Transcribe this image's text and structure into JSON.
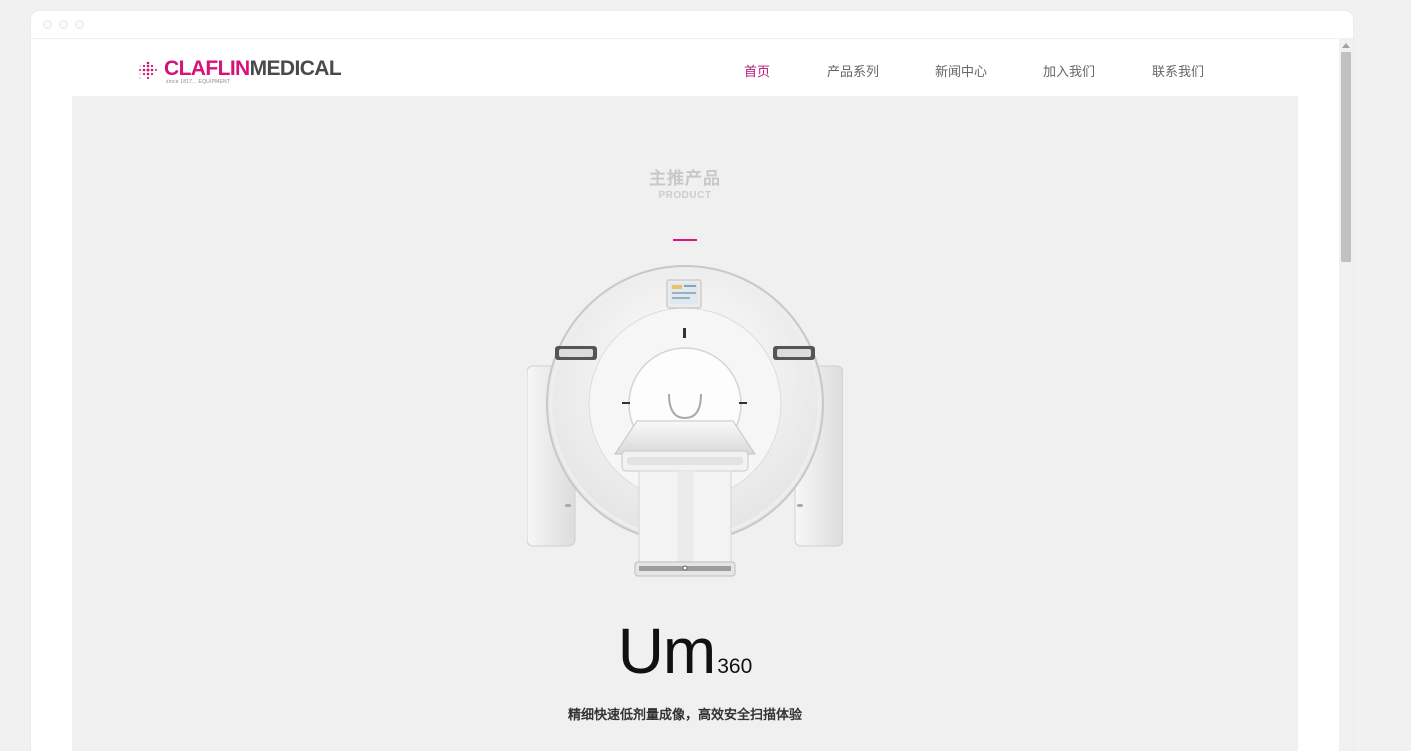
{
  "brand": {
    "name_part1": "CLAFLIN",
    "name_part2": "MEDICAL",
    "tagline": "since 1817... EQUIPMENT",
    "accent_color": "#d8117a"
  },
  "nav": {
    "items": [
      {
        "label": "首页",
        "active": true
      },
      {
        "label": "产品系列",
        "active": false
      },
      {
        "label": "新闻中心",
        "active": false
      },
      {
        "label": "加入我们",
        "active": false
      },
      {
        "label": "联系我们",
        "active": false
      }
    ],
    "active_color": "#b5157a"
  },
  "section": {
    "title": "主推产品",
    "subtitle": "PRODUCT"
  },
  "product": {
    "image_icon": "ct-scanner-image",
    "model_main": "Um",
    "model_number": "360",
    "tagline": "精细快速低剂量成像，高效安全扫描体验"
  }
}
